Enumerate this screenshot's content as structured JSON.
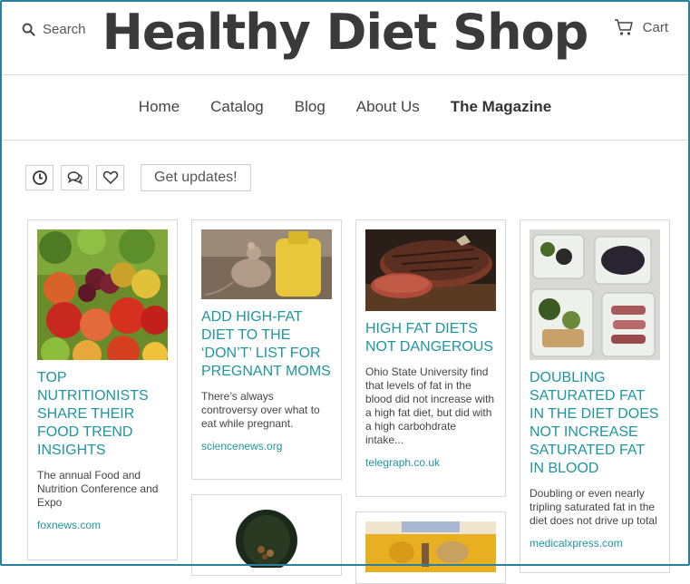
{
  "header": {
    "search_label": "Search",
    "logo": "Healthy Diet Shop",
    "cart_label": "Cart"
  },
  "nav": {
    "items": [
      {
        "label": "Home"
      },
      {
        "label": "Catalog"
      },
      {
        "label": "Blog"
      },
      {
        "label": "About Us"
      },
      {
        "label": "The Magazine",
        "active": true
      }
    ]
  },
  "toolbar": {
    "icons": [
      "clock-icon",
      "comments-icon",
      "heart-icon"
    ],
    "updates_label": "Get updates!"
  },
  "cards": [
    {
      "title": "TOP NUTRITIONISTS SHARE THEIR FOOD TREND INSIGHTS",
      "excerpt": "The annual Food and Nutrition Conference and Expo",
      "source": "foxnews.com",
      "image": "fruits-vegetables-photo"
    },
    {
      "title": "ADD HIGH-FAT DIET TO THE ‘DON’T’ LIST FOR PREGNANT MOMS",
      "excerpt": "There’s always controversy over what to eat while pregnant.",
      "source": "sciencenews.org",
      "image": "mouse-oil-bottle-photo"
    },
    {
      "title": "HIGH FAT DIETS NOT DANGEROUS",
      "excerpt": "Ohio State University find that levels of fat in the blood did not increase with a high fat diet, but did with a high carbohdrate intake...",
      "source": "telegraph.co.uk",
      "image": "steak-photo"
    },
    {
      "title": "DOUBLING SATURATED FAT IN THE DIET DOES NOT INCREASE SATURATED FAT IN BLOOD",
      "excerpt": "Doubling or even nearly tripling saturated fat in the diet does not drive up total",
      "source": "medicalxpress.com",
      "image": "meal-containers-photo"
    },
    {
      "image": "pill-bottle-photo"
    },
    {
      "image": "food-tray-photo"
    }
  ],
  "colors": {
    "accent": "#1f95a0",
    "frame": "#2a7f9c"
  }
}
